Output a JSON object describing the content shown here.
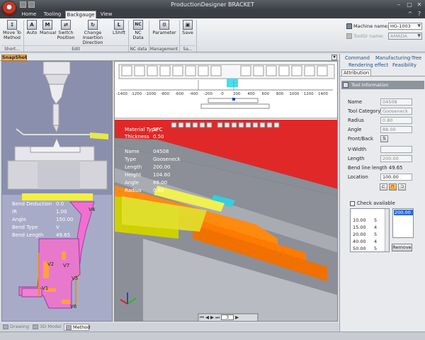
{
  "window": {
    "title": "ProductionDesigner  BRACKET"
  },
  "tabs": [
    {
      "label": "Home",
      "active": false
    },
    {
      "label": "Tooling",
      "active": false
    },
    {
      "label": "Backgauge",
      "active": true
    },
    {
      "label": "View",
      "active": false
    }
  ],
  "ribbon": {
    "buttons": [
      {
        "label": "Move To Method",
        "icon": "move-to-method-icon"
      },
      {
        "label": "Auto",
        "icon": "auto-icon"
      },
      {
        "label": "Manual",
        "icon": "manual-icon"
      },
      {
        "label": "Switch Position",
        "icon": "switch-position-icon"
      },
      {
        "label": "Change Insertion Direction",
        "icon": "change-direction-icon"
      },
      {
        "label": "LShift",
        "icon": "lshift-icon"
      },
      {
        "label": "NC Data",
        "icon": "nc-data-icon"
      },
      {
        "label": "Parameter",
        "icon": "parameter-icon"
      },
      {
        "label": "Save",
        "icon": "save-icon"
      }
    ],
    "groups": [
      "Short...",
      "Edit",
      "NC data",
      "Management",
      "Sa..."
    ],
    "machine_label": "Machine name:",
    "machine_value": "HG-1003",
    "toolgr_label": "ToolGr name:",
    "toolgr_value": "AMADA"
  },
  "snapshot_tab": "SnapShot",
  "left_view": {
    "lines": [
      {
        "label": "Bend Deduction",
        "value": "0.0"
      },
      {
        "label": "IR",
        "value": "1.00"
      },
      {
        "label": "Angle",
        "value": "150.00"
      },
      {
        "label": "Bend Type",
        "value": "V"
      },
      {
        "label": "Bend Length",
        "value": "49.65"
      }
    ],
    "part_labels": [
      "V4",
      "V2",
      "V7",
      "V5",
      "V1",
      "V6"
    ]
  },
  "main_view": {
    "ruler_ticks": [
      "-1400",
      "-1200",
      "-1000",
      "-800",
      "-600",
      "-400",
      "-200",
      "0",
      "200",
      "400",
      "600",
      "800",
      "1000",
      "1200",
      "1400"
    ],
    "material": {
      "label": "Material Type",
      "value": "SPC"
    },
    "thickness": {
      "label": "Thickness",
      "value": "0.50"
    },
    "tool_info": [
      {
        "label": "Name",
        "value": "04508"
      },
      {
        "label": "Type",
        "value": "Gooseneck"
      },
      {
        "label": "Length",
        "value": "200.00"
      },
      {
        "label": "Height",
        "value": "104.60"
      },
      {
        "label": "Angle",
        "value": "88.00"
      },
      {
        "label": "Radius",
        "value": "0.80"
      }
    ],
    "page_number": "3"
  },
  "bottom_tabs": [
    {
      "label": "Drawing",
      "active": false
    },
    {
      "label": "3D Model",
      "active": false
    },
    {
      "label": "Method",
      "active": true
    }
  ],
  "right_panel": {
    "tabs_row1": [
      "Command",
      "Manufacturing-Tree"
    ],
    "tabs_row2": [
      "Rendering effect",
      "Feasibility"
    ],
    "tabs_row3": [
      "Attribution"
    ],
    "tool_information": "Tool Information",
    "fields": [
      {
        "label": "Name",
        "value": "04508"
      },
      {
        "label": "Tool Category",
        "value": "Gooseneck"
      },
      {
        "label": "Radius",
        "value": "0.80"
      },
      {
        "label": "Angle",
        "value": "88.00"
      }
    ],
    "front_back_label": "Front/Back",
    "v_width_label": "V-Width",
    "length_label": "Length",
    "length_value": "200.00",
    "bend_line_label": "Bend line length",
    "bend_line_value": "49.65",
    "location_label": "Location",
    "location_value": "100.00",
    "check_available": "Check available",
    "list_rows": [
      {
        "a": "10.00",
        "b": "5"
      },
      {
        "a": "15.00",
        "b": "4"
      },
      {
        "a": "20.00",
        "b": "5"
      },
      {
        "a": "40.00",
        "b": "4"
      },
      {
        "a": "50.00",
        "b": "5"
      }
    ],
    "selected_value": "200.00",
    "remove_label": "Remove"
  }
}
